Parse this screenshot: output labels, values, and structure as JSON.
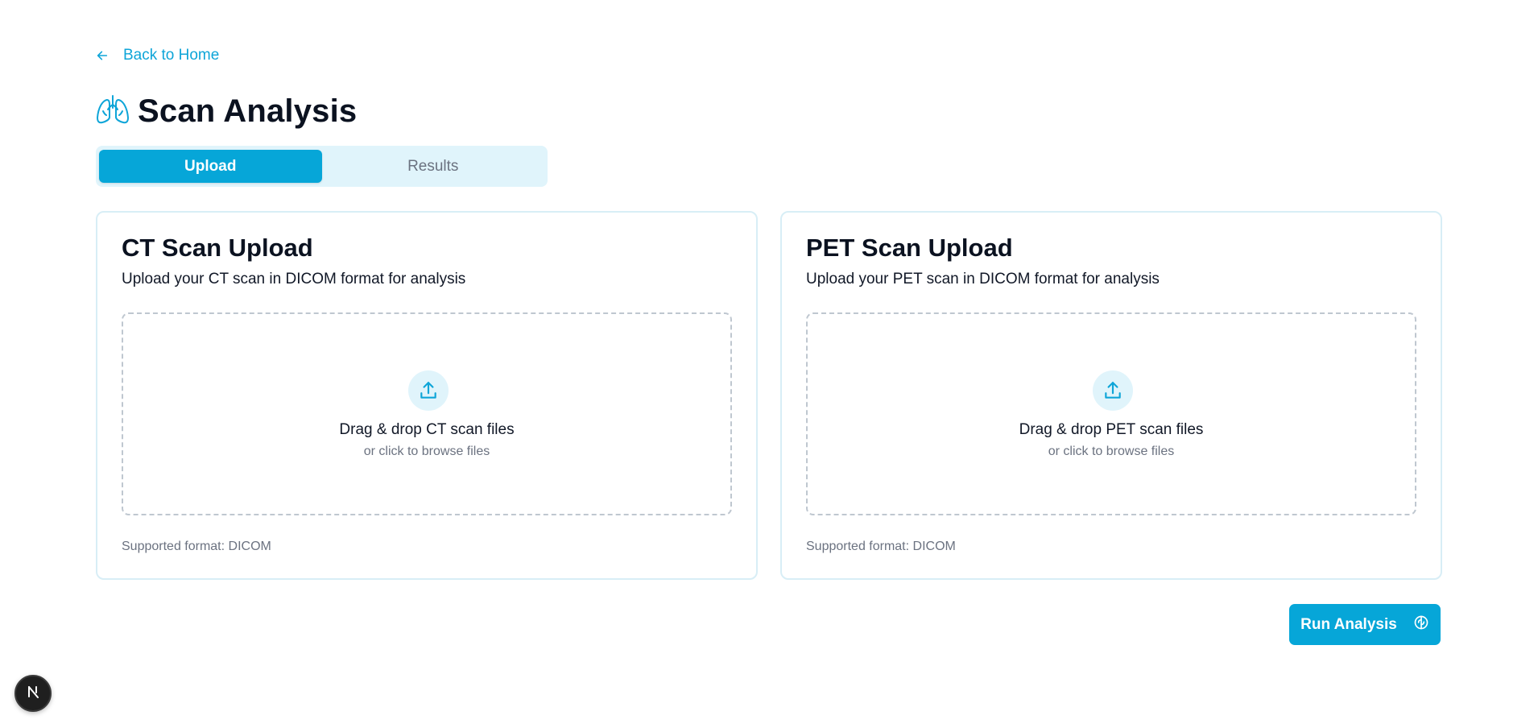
{
  "nav": {
    "back_label": "Back to Home"
  },
  "page": {
    "title": "Scan Analysis",
    "title_icon": "lungs-icon"
  },
  "tabs": [
    {
      "label": "Upload",
      "active": true
    },
    {
      "label": "Results",
      "active": false
    }
  ],
  "ct_card": {
    "title": "CT Scan Upload",
    "description": "Upload your CT scan in DICOM format for analysis",
    "drop_title": "Drag & drop CT scan files",
    "drop_subtitle": "or click to browse files",
    "supported": "Supported format: DICOM",
    "icon": "upload-icon"
  },
  "pet_card": {
    "title": "PET Scan Upload",
    "description": "Upload your PET scan in DICOM format for analysis",
    "drop_title": "Drag & drop PET scan files",
    "drop_subtitle": "or click to browse files",
    "supported": "Supported format: DICOM",
    "icon": "upload-icon"
  },
  "actions": {
    "run_label": "Run Analysis",
    "run_icon": "brain-icon"
  },
  "colors": {
    "accent": "#06a6d8",
    "accent_light": "#e0f4fb",
    "text_dark": "#0b1220",
    "text_muted": "#6b7280"
  }
}
